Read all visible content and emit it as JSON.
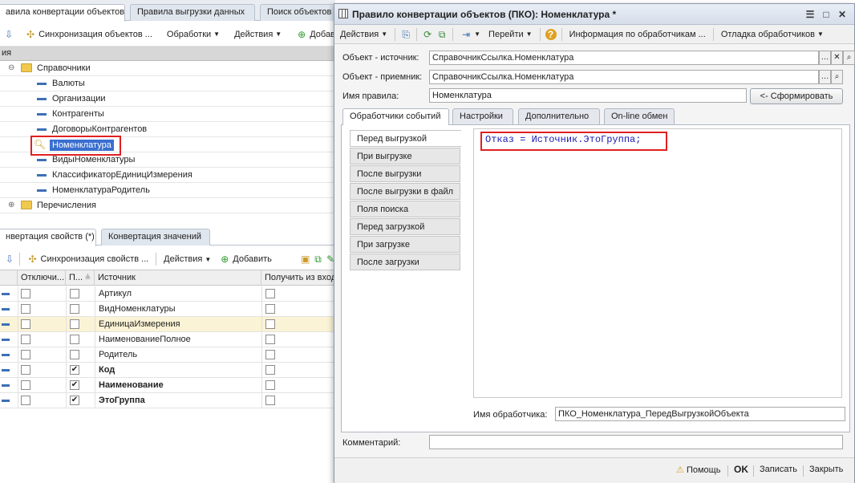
{
  "left": {
    "top_tabs": [
      "авила конвертации объектов",
      "Правила выгрузки данных",
      "Поиск объектов"
    ],
    "toolbar1": {
      "sync": "Синхронизация объектов ...",
      "processing": "Обработки",
      "actions": "Действия",
      "add": "Добавить"
    },
    "tree_header": "ия",
    "tree": [
      {
        "label": "Справочники",
        "kind": "folder",
        "expanded": true
      },
      {
        "label": "Валюты",
        "kind": "item"
      },
      {
        "label": "Организации",
        "kind": "item"
      },
      {
        "label": "Контрагенты",
        "kind": "item"
      },
      {
        "label": "ДоговорыКонтрагентов",
        "kind": "item"
      },
      {
        "label": "Номенклатура",
        "kind": "item",
        "selected": true
      },
      {
        "label": "ВидыНоменклатуры",
        "kind": "item"
      },
      {
        "label": "КлассификаторЕдиницИзмерения",
        "kind": "item"
      },
      {
        "label": "НоменклатураРодитель",
        "kind": "item"
      },
      {
        "label": "Перечисления",
        "kind": "folder",
        "expanded": false
      }
    ],
    "bottom_tabs": [
      "нвертация свойств (*)",
      "Конвертация значений"
    ],
    "toolbar2": {
      "sync": "Синхронизация свойств ...",
      "actions": "Действия",
      "add": "Добавить"
    },
    "grid_columns": [
      "Отключи...",
      "П...",
      "Источник",
      "Получить из входя"
    ],
    "grid_rows": [
      {
        "source": "Артикул",
        "p": false,
        "bold": false
      },
      {
        "source": "ВидНоменклатуры",
        "p": false,
        "bold": false
      },
      {
        "source": "ЕдиницаИзмерения",
        "p": false,
        "bold": false
      },
      {
        "source": "НаименованиеПолное",
        "p": false,
        "bold": false
      },
      {
        "source": "Родитель",
        "p": false,
        "bold": false
      },
      {
        "source": "Код",
        "p": true,
        "bold": true
      },
      {
        "source": "Наименование",
        "p": true,
        "bold": true
      },
      {
        "source": "ЭтоГруппа",
        "p": true,
        "bold": true
      }
    ]
  },
  "dialog": {
    "title": "Правило конвертации объектов (ПКО): Номенклатура *",
    "toolbar": {
      "actions": "Действия",
      "goto": "Перейти",
      "info": "Информация по обработчикам ...",
      "debug": "Отладка обработчиков"
    },
    "source_label": "Объект - источник:",
    "source_value": "СправочникСсылка.Номенклатура",
    "target_label": "Объект - приемник:",
    "target_value": "СправочникСсылка.Номенклатура",
    "rule_name_label": "Имя правила:",
    "rule_name_value": "Номенклатура",
    "generate_button": "<- Сформировать",
    "tabs": [
      "Обработчики событий",
      "Настройки",
      "Дополнительно",
      "On-line обмен"
    ],
    "handlers": [
      "Перед выгрузкой",
      "При выгрузке",
      "После выгрузки",
      "После выгрузки в файл",
      "Поля поиска",
      "Перед загрузкой",
      "При загрузке",
      "После загрузки"
    ],
    "code": "Отказ = Источник.ЭтоГруппа;",
    "handler_name_label": "Имя обработчика:",
    "handler_name_value": "ПКО_Номенклатура_ПередВыгрузкойОбъекта",
    "comment_label": "Комментарий:",
    "comment_value": "",
    "footer": {
      "help": "Помощь",
      "ok": "OK",
      "save": "Записать",
      "close": "Закрыть"
    }
  }
}
